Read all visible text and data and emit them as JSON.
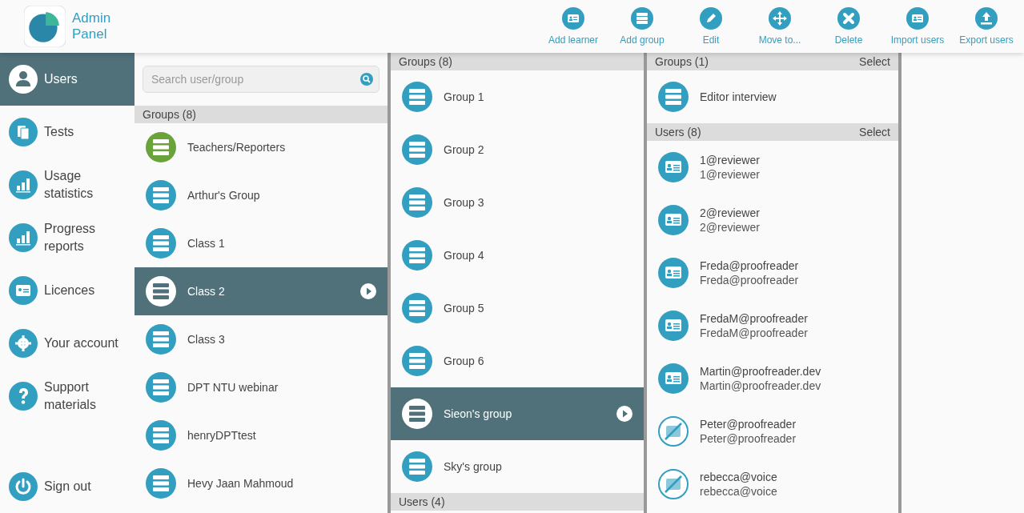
{
  "app": {
    "title_line1": "Admin",
    "title_line2": "Panel"
  },
  "toolbar": [
    "Add learner",
    "Add group",
    "Edit",
    "Move to...",
    "Delete",
    "Import users",
    "Export users"
  ],
  "sidebar": {
    "items": [
      {
        "label": "Users",
        "selected": true
      },
      {
        "label": "Tests",
        "selected": false
      },
      {
        "label": "Usage statistics",
        "selected": false
      },
      {
        "label": "Progress reports",
        "selected": false
      },
      {
        "label": "Licences",
        "selected": false
      },
      {
        "label": "Your account",
        "selected": false
      },
      {
        "label": "Support materials",
        "selected": false
      }
    ],
    "sign_out": "Sign out"
  },
  "search": {
    "placeholder": "Search user/group"
  },
  "column_1": {
    "groups_header": "Groups (8)",
    "groups": [
      {
        "name": "Teachers/Reporters",
        "color": "#6aa33a",
        "selected": false
      },
      {
        "name": "Arthur's Group",
        "color": "#339fc0",
        "selected": false
      },
      {
        "name": "Class 1",
        "color": "#339fc0",
        "selected": false
      },
      {
        "name": "Class 2",
        "selected": true
      },
      {
        "name": "Class 3",
        "color": "#339fc0",
        "selected": false
      },
      {
        "name": "DPT NTU webinar",
        "color": "#339fc0",
        "selected": false
      },
      {
        "name": "henryDPTtest",
        "color": "#339fc0",
        "selected": false
      },
      {
        "name": "Hevy Jaan Mahmoud",
        "color": "#339fc0",
        "selected": false
      }
    ]
  },
  "column_2": {
    "groups_header": "Groups (8)",
    "groups": [
      {
        "name": "Group 1",
        "selected": false
      },
      {
        "name": "Group 2",
        "selected": false
      },
      {
        "name": "Group 3",
        "selected": false
      },
      {
        "name": "Group 4",
        "selected": false
      },
      {
        "name": "Group 5",
        "selected": false
      },
      {
        "name": "Group 6",
        "selected": false
      },
      {
        "name": "Sieon's group",
        "selected": true
      },
      {
        "name": "Sky's group",
        "selected": false
      }
    ],
    "users_header": "Users (4)"
  },
  "column_3": {
    "groups_header": "Groups (1)",
    "groups_action": "Select",
    "groups": [
      {
        "name": "Editor interview"
      }
    ],
    "users_header": "Users (8)",
    "users_action": "Select",
    "users": [
      {
        "name": "1@reviewer",
        "login": "1@reviewer",
        "disabled": false
      },
      {
        "name": "2@reviewer",
        "login": "2@reviewer",
        "disabled": false
      },
      {
        "name": "Freda@proofreader",
        "login": "Freda@proofreader",
        "disabled": false
      },
      {
        "name": "FredaM@proofreader",
        "login": "FredaM@proofreader",
        "disabled": false
      },
      {
        "name": "Martin@proofreader.dev",
        "login": "Martin@proofreader.dev",
        "disabled": false
      },
      {
        "name": "Peter@proofreader",
        "login": "Peter@proofreader",
        "disabled": true
      },
      {
        "name": "rebecca@voice",
        "login": "rebecca@voice",
        "disabled": true
      }
    ]
  }
}
